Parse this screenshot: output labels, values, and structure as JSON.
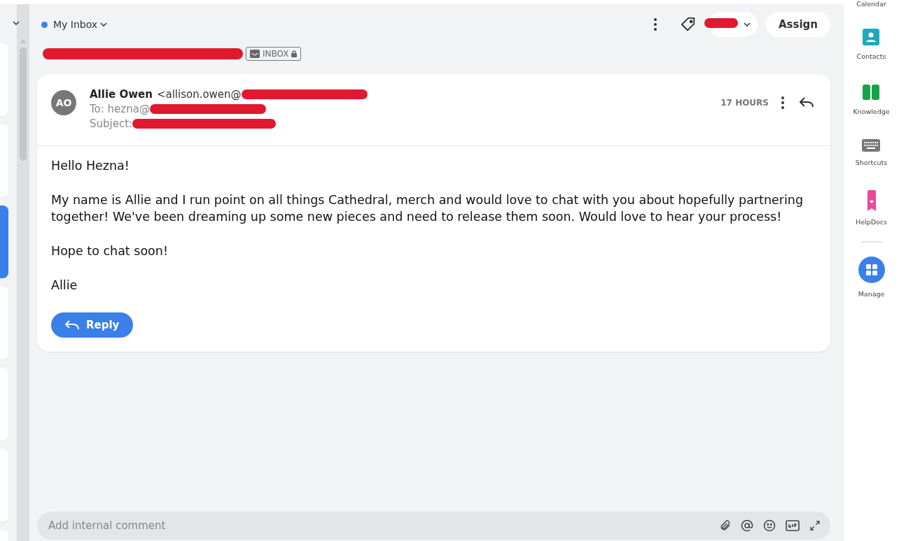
{
  "conversation_list": [
    {
      "selected": false
    },
    {
      "selected": false
    },
    {
      "selected": true
    },
    {
      "selected": false
    },
    {
      "selected": false
    },
    {
      "selected": false
    },
    {
      "selected": false
    }
  ],
  "header": {
    "inbox_label": "My Inbox",
    "assign_button": "Assign"
  },
  "title": {
    "badge": "INBOX"
  },
  "message": {
    "avatar": "AO",
    "sender_name": "Allie Owen",
    "sender_email": "<allison.owen@",
    "to": "To: hezna@",
    "subject": "Subject:",
    "time": "17 HOURS",
    "body": [
      "Hello Hezna!",
      "My name is Allie and I run point on all things Cathedral, merch and would love to chat with you about hopefully partnering together! We've been dreaming up some new pieces and need to release them soon. Would love to hear your process!",
      "Hope to chat soon!",
      "Allie"
    ],
    "reply_button": "Reply"
  },
  "comment": {
    "placeholder": "Add internal comment"
  },
  "sidebar": {
    "items": [
      {
        "label": "Calendar"
      },
      {
        "label": "Contacts",
        "kind": "contacts"
      },
      {
        "label": "Knowledge",
        "kind": "knowledge"
      },
      {
        "label": "Shortcuts",
        "kind": "shortcuts"
      },
      {
        "label": "HelpDocs",
        "kind": "helpdocs"
      },
      {
        "label": "Manage",
        "kind": "manage"
      }
    ]
  }
}
